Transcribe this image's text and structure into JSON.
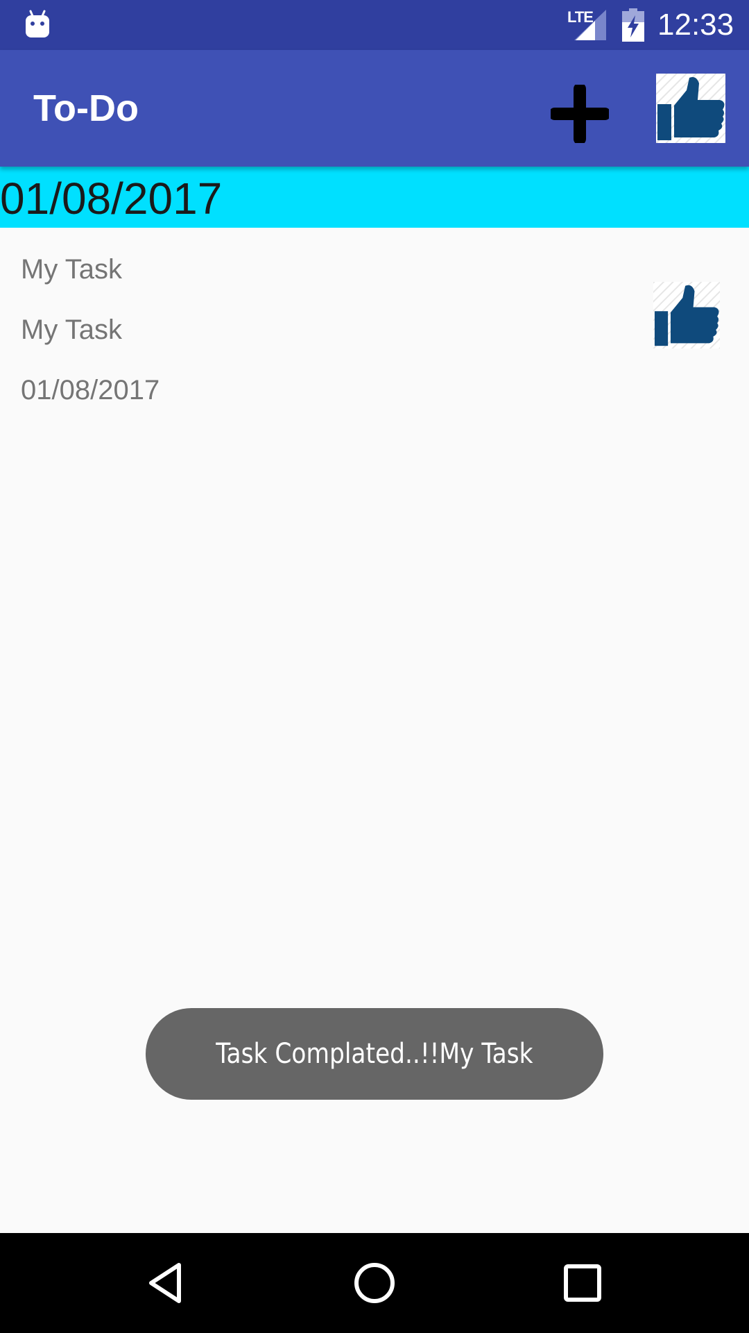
{
  "status_bar": {
    "network": "LTE",
    "time": "12:33",
    "icons": [
      "android-icon",
      "signal-icon",
      "battery-charging-icon"
    ]
  },
  "toolbar": {
    "title": "To-Do",
    "actions": [
      "add-icon",
      "thumbs-up-icon"
    ]
  },
  "date_header": {
    "date": "01/08/2017"
  },
  "task": {
    "title": "My Task",
    "description": "My Task",
    "date": "01/08/2017",
    "action_icon": "thumbs-up-icon"
  },
  "toast": {
    "message": "Task Complated..!!My Task"
  },
  "navigation": {
    "buttons": [
      "back-icon",
      "home-icon",
      "recents-icon"
    ]
  },
  "colors": {
    "status_bar": "#303f9f",
    "toolbar": "#3f51b5",
    "date_header": "#00e0ff",
    "thumbs_up": "#0f4a7c",
    "toast": "#666666"
  }
}
